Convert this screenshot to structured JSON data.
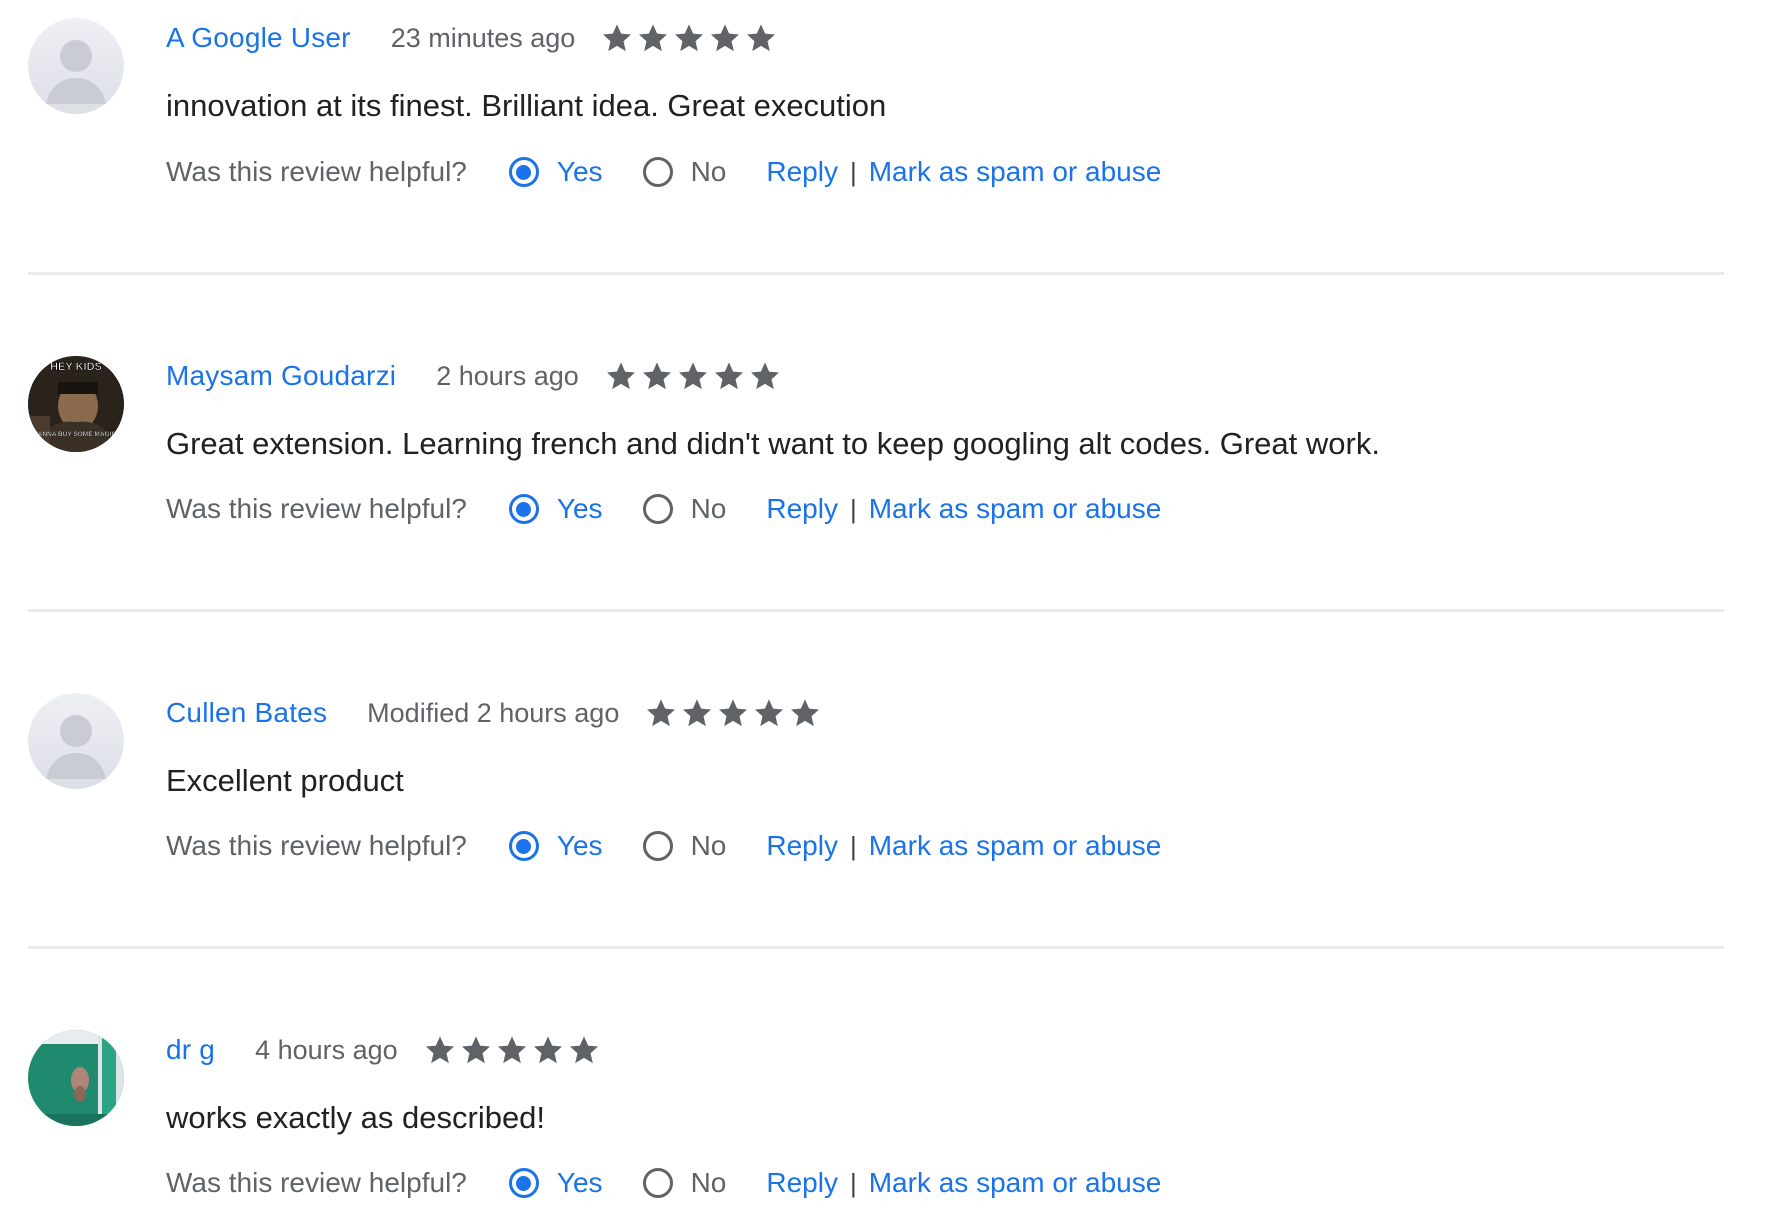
{
  "helpful_question": "Was this review helpful?",
  "yes_label": "Yes",
  "no_label": "No",
  "reply_label": "Reply",
  "separator": "|",
  "spam_label": "Mark as spam or abuse",
  "colors": {
    "link": "#1a73e8",
    "star": "#5f6368",
    "divider": "#e8eaed"
  },
  "reviews": [
    {
      "author": "A Google User",
      "date": "23 minutes ago",
      "rating": 5,
      "text": "innovation at its finest. Brilliant idea. Great execution",
      "avatar": "default-person-icon",
      "helpful_selected": "yes"
    },
    {
      "author": "Maysam Goudarzi",
      "date": "2 hours ago",
      "rating": 5,
      "text": "Great extension. Learning french and didn't want to keep googling alt codes. Great work.",
      "avatar": "meme-photo",
      "avatar_caption_top": "HEY KIDS",
      "avatar_caption_bottom": "WANNA BUY SOME MAGIC?",
      "helpful_selected": "yes"
    },
    {
      "author": "Cullen Bates",
      "date": "Modified 2 hours ago",
      "rating": 5,
      "text": "Excellent product",
      "avatar": "default-person-icon",
      "helpful_selected": "yes"
    },
    {
      "author": "dr g",
      "date": "4 hours ago",
      "rating": 5,
      "text": "works exactly as described!",
      "avatar": "green-photo",
      "helpful_selected": "yes"
    }
  ]
}
